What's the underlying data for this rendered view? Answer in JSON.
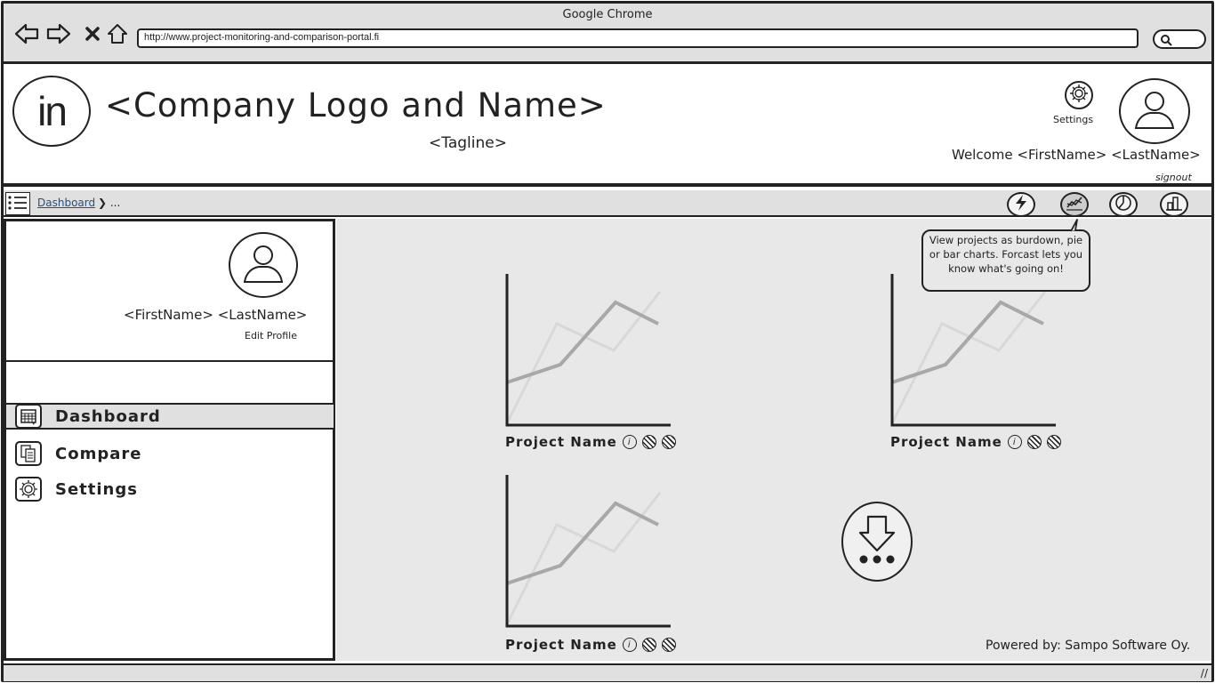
{
  "browser": {
    "title": "Google Chrome",
    "url": "http://www.project-monitoring-and-comparison-portal.fi",
    "nav_icons": [
      "back-icon",
      "forward-icon",
      "close-icon",
      "home-icon"
    ]
  },
  "header": {
    "logo_text": "in",
    "company_name": "<Company Logo and Name>",
    "tagline": "<Tagline>",
    "settings_label": "Settings",
    "welcome": "Welcome <FirstName> <LastName>",
    "signout": "signout"
  },
  "breadcrumb": {
    "link": "Dashboard",
    "separator": "❯ ..."
  },
  "toolbar": {
    "buttons": [
      "forecast-icon",
      "burndown-chart-icon",
      "pie-chart-icon",
      "bar-chart-icon"
    ],
    "active": "burndown-chart-icon",
    "tooltip": "View projects as burdown, pie or bar charts. Forcast lets you know what's going on!"
  },
  "sidebar": {
    "name": "<FirstName> <LastName>",
    "edit_profile": "Edit Profile",
    "items": [
      {
        "label": "Dashboard",
        "icon": "calendar-icon",
        "active": true
      },
      {
        "label": "Compare",
        "icon": "compare-icon",
        "active": false
      },
      {
        "label": "Settings",
        "icon": "gear-icon",
        "active": false
      }
    ]
  },
  "projects": [
    {
      "name": "Project Name"
    },
    {
      "name": "Project Name"
    },
    {
      "name": "Project Name"
    }
  ],
  "footer": {
    "powered_by": "Powered by: Sampo Software Oy."
  },
  "colors": {
    "chrome_gray": "#e0e0e0",
    "content_gray": "#e8e8e8",
    "link_blue": "#2a4f7c"
  }
}
